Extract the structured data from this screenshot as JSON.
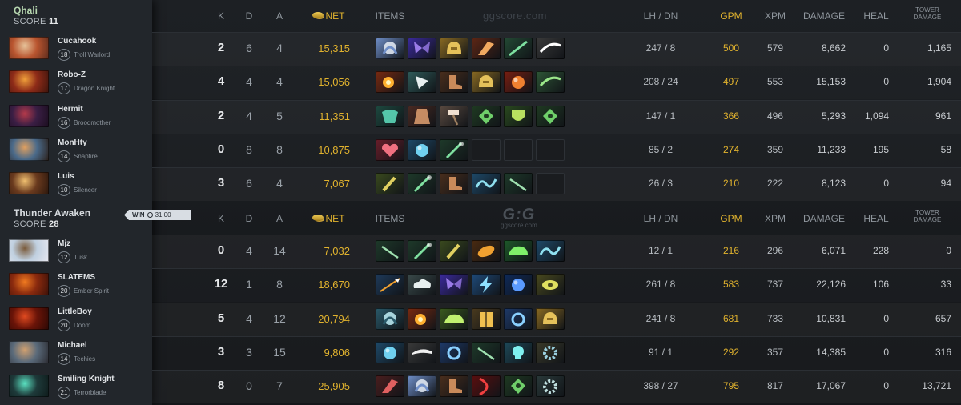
{
  "headers": {
    "k": "K",
    "d": "D",
    "a": "A",
    "net": "NET",
    "items": "ITEMS",
    "lhdn": "LH / DN",
    "gpm": "GPM",
    "xpm": "XPM",
    "damage": "DAMAGE",
    "heal": "HEAL",
    "tower": "TOWER DAMAGE"
  },
  "watermark_top": "ggscore.com",
  "watermark_logo": "G:G",
  "watermark_logo_sub": "ggscore.com",
  "result": {
    "label": "WIN",
    "time": "31:00"
  },
  "teams": [
    {
      "name": "Qhali",
      "score_label": "SCORE",
      "score": "11",
      "players": [
        {
          "name": "Cucahook",
          "level": "18",
          "hero": "Troll Warlord",
          "k": "2",
          "d": "6",
          "a": "4",
          "net": "15,315",
          "lhdn": "247 / 8",
          "gpm": "500",
          "xpm": "579",
          "damage": "8,662",
          "heal": "0",
          "tower": "1,165",
          "portrait": [
            "#b9552f",
            "#e6c39a",
            "#5a2a1c"
          ],
          "items": [
            {
              "icon": "skadi-icon",
              "colors": [
                "#6f8fc9",
                "#e8eef8"
              ]
            },
            {
              "icon": "butterfly-icon",
              "colors": [
                "#3b2a9e",
                "#9a7be8"
              ]
            },
            {
              "icon": "helmet-icon",
              "colors": [
                "#8a6a22",
                "#e5c15a"
              ]
            },
            {
              "icon": "claw-icon",
              "colors": [
                "#5e2614",
                "#f0a860"
              ]
            },
            {
              "icon": "sword-icon",
              "colors": [
                "#234a34",
                "#7de0a0"
              ]
            },
            {
              "icon": "scythe-icon",
              "colors": [
                "#3a3a3a",
                "#ffffff"
              ]
            }
          ]
        },
        {
          "name": "Robo-Z",
          "level": "17",
          "hero": "Dragon Knight",
          "k": "4",
          "d": "4",
          "a": "4",
          "net": "15,056",
          "lhdn": "208 / 24",
          "gpm": "497",
          "xpm": "553",
          "damage": "15,153",
          "heal": "0",
          "tower": "1,904",
          "portrait": [
            "#8e2b18",
            "#f0a03a",
            "#3c140c"
          ],
          "items": [
            {
              "icon": "radiance-icon",
              "colors": [
                "#7a2a10",
                "#ffb030"
              ]
            },
            {
              "icon": "axe-icon",
              "colors": [
                "#2f5c5a",
                "#e8f0f0"
              ]
            },
            {
              "icon": "boots-icon",
              "colors": [
                "#4a2e1c",
                "#c98a5a"
              ]
            },
            {
              "icon": "helmet-icon",
              "colors": [
                "#8a6a22",
                "#e5c15a"
              ]
            },
            {
              "icon": "orb-icon",
              "colors": [
                "#7a1e10",
                "#f08030"
              ]
            },
            {
              "icon": "scythe-icon",
              "colors": [
                "#2e5636",
                "#9be88a"
              ]
            }
          ]
        },
        {
          "name": "Hermit",
          "level": "16",
          "hero": "Broodmother",
          "k": "2",
          "d": "4",
          "a": "5",
          "net": "11,351",
          "lhdn": "147 / 1",
          "gpm": "366",
          "xpm": "496",
          "damage": "5,293",
          "heal": "1,094",
          "tower": "961",
          "portrait": [
            "#3a1e44",
            "#b53a4a",
            "#1a0d1e"
          ],
          "items": [
            {
              "icon": "mask-icon",
              "colors": [
                "#1d4a40",
                "#5fe0c0"
              ]
            },
            {
              "icon": "cape-icon",
              "colors": [
                "#4a2a22",
                "#e0a070"
              ]
            },
            {
              "icon": "hammer-icon",
              "colors": [
                "#5a4a40",
                "#f0e0d0"
              ]
            },
            {
              "icon": "amulet-icon",
              "colors": [
                "#1f3a22",
                "#6fcf6a"
              ]
            },
            {
              "icon": "shield-icon",
              "colors": [
                "#2a4a1e",
                "#b8e060"
              ]
            },
            {
              "icon": "amulet-icon",
              "colors": [
                "#1f3a22",
                "#6fcf6a"
              ]
            }
          ]
        },
        {
          "name": "MonHty",
          "level": "14",
          "hero": "Snapfire",
          "k": "0",
          "d": "8",
          "a": "8",
          "net": "10,875",
          "lhdn": "85 / 2",
          "gpm": "274",
          "xpm": "359",
          "damage": "11,233",
          "heal": "195",
          "tower": "58",
          "portrait": [
            "#4a6a8a",
            "#e0a060",
            "#2a1e18"
          ],
          "items": [
            {
              "icon": "heart-icon",
              "colors": [
                "#6a1e2a",
                "#f07080"
              ]
            },
            {
              "icon": "orb-icon",
              "colors": [
                "#1e4a6a",
                "#6fd0f0"
              ]
            },
            {
              "icon": "staff-icon",
              "colors": [
                "#1e3a2a",
                "#7fe0a0"
              ]
            },
            {
              "icon": "empty-slot",
              "colors": [
                "#1a1c1f",
                "#1a1c1f"
              ]
            },
            {
              "icon": "empty-slot",
              "colors": [
                "#1a1c1f",
                "#1a1c1f"
              ]
            },
            {
              "icon": "empty-slot",
              "colors": [
                "#1a1c1f",
                "#1a1c1f"
              ]
            }
          ]
        },
        {
          "name": "Luis",
          "level": "10",
          "hero": "Silencer",
          "k": "3",
          "d": "6",
          "a": "4",
          "net": "7,067",
          "lhdn": "26 / 3",
          "gpm": "210",
          "xpm": "222",
          "damage": "8,123",
          "heal": "0",
          "tower": "94",
          "portrait": [
            "#6a3a1e",
            "#f0c070",
            "#2a160c"
          ],
          "items": [
            {
              "icon": "wand-icon",
              "colors": [
                "#3a4a1e",
                "#e0d060"
              ]
            },
            {
              "icon": "staff-icon",
              "colors": [
                "#1e3a2a",
                "#7fe0a0"
              ]
            },
            {
              "icon": "boots-icon",
              "colors": [
                "#4a2e1c",
                "#c98a5a"
              ]
            },
            {
              "icon": "wave-icon",
              "colors": [
                "#1e4a6a",
                "#8fe0f0"
              ]
            },
            {
              "icon": "stick-icon",
              "colors": [
                "#1e3a2a",
                "#9fe0b0"
              ]
            },
            {
              "icon": "empty-slot",
              "colors": [
                "#1a1c1f",
                "#1a1c1f"
              ]
            }
          ]
        }
      ]
    },
    {
      "name": "Thunder Awaken",
      "score_label": "SCORE",
      "score": "28",
      "players": [
        {
          "name": "Mjz",
          "level": "12",
          "hero": "Tusk",
          "k": "0",
          "d": "4",
          "a": "14",
          "net": "7,032",
          "lhdn": "12 / 1",
          "gpm": "216",
          "xpm": "296",
          "damage": "6,071",
          "heal": "228",
          "tower": "0",
          "portrait": [
            "#c0d0e0",
            "#7a5a3a",
            "#e8e8f0"
          ],
          "items": [
            {
              "icon": "stick-icon",
              "colors": [
                "#1e3a2a",
                "#9fe0b0"
              ]
            },
            {
              "icon": "staff-icon",
              "colors": [
                "#1e3a2a",
                "#7fe0a0"
              ]
            },
            {
              "icon": "wand-icon",
              "colors": [
                "#3a4a1e",
                "#e0d060"
              ]
            },
            {
              "icon": "feather-icon",
              "colors": [
                "#4a2a10",
                "#f0a030"
              ]
            },
            {
              "icon": "slipper-icon",
              "colors": [
                "#1e5a2a",
                "#7ff06a"
              ]
            },
            {
              "icon": "wave-icon",
              "colors": [
                "#1e4a6a",
                "#8fe0f0"
              ]
            }
          ]
        },
        {
          "name": "SLATEMS",
          "level": "20",
          "hero": "Ember Spirit",
          "k": "12",
          "d": "1",
          "a": "8",
          "net": "18,670",
          "lhdn": "261 / 8",
          "gpm": "583",
          "xpm": "737",
          "damage": "22,126",
          "heal": "106",
          "tower": "33",
          "portrait": [
            "#8a2a0e",
            "#f07a20",
            "#3a1008"
          ],
          "items": [
            {
              "icon": "spear-icon",
              "colors": [
                "#1e3a5a",
                "#f0a030"
              ]
            },
            {
              "icon": "cloud-icon",
              "colors": [
                "#3a4a4a",
                "#e8f0f0"
              ]
            },
            {
              "icon": "butterfly-icon",
              "colors": [
                "#3b2a9e",
                "#9a7be8"
              ]
            },
            {
              "icon": "lightning-icon",
              "colors": [
                "#1e4a7a",
                "#8fe0ff"
              ]
            },
            {
              "icon": "orb-icon",
              "colors": [
                "#0e2a5a",
                "#5a9aff"
              ]
            },
            {
              "icon": "eye-icon",
              "colors": [
                "#4a4a1e",
                "#e0e060"
              ]
            }
          ]
        },
        {
          "name": "LittleBoy",
          "level": "20",
          "hero": "Doom",
          "k": "5",
          "d": "4",
          "a": "12",
          "net": "20,794",
          "lhdn": "241 / 8",
          "gpm": "681",
          "xpm": "733",
          "damage": "10,831",
          "heal": "0",
          "tower": "657",
          "portrait": [
            "#6a1408",
            "#e04a20",
            "#2a0804"
          ],
          "items": [
            {
              "icon": "skadi-icon",
              "colors": [
                "#2a5a6a",
                "#c0f0f8"
              ]
            },
            {
              "icon": "radiance-icon",
              "colors": [
                "#7a2a10",
                "#ffb030"
              ]
            },
            {
              "icon": "slipper-icon",
              "colors": [
                "#3a5a1e",
                "#c0f070"
              ]
            },
            {
              "icon": "book-icon",
              "colors": [
                "#4a3a1e",
                "#f0c050"
              ]
            },
            {
              "icon": "ring-icon",
              "colors": [
                "#1e3a6a",
                "#8ad0ff"
              ]
            },
            {
              "icon": "helmet-icon",
              "colors": [
                "#8a6a22",
                "#e5c15a"
              ]
            }
          ]
        },
        {
          "name": "Michael",
          "level": "14",
          "hero": "Techies",
          "k": "3",
          "d": "3",
          "a": "15",
          "net": "9,806",
          "lhdn": "91 / 1",
          "gpm": "292",
          "xpm": "357",
          "damage": "14,385",
          "heal": "0",
          "tower": "316",
          "portrait": [
            "#5a6a7a",
            "#d0a070",
            "#2a2a30"
          ],
          "items": [
            {
              "icon": "orb-icon",
              "colors": [
                "#1e4a6a",
                "#6fd0f0"
              ]
            },
            {
              "icon": "blade-icon",
              "colors": [
                "#3a3a3a",
                "#f0f0f0"
              ]
            },
            {
              "icon": "ring-icon",
              "colors": [
                "#1e3a6a",
                "#8ad0ff"
              ]
            },
            {
              "icon": "stick-icon",
              "colors": [
                "#1e3a2a",
                "#9fe0b0"
              ]
            },
            {
              "icon": "skull-icon",
              "colors": [
                "#1e4a5a",
                "#7ff0f0"
              ]
            },
            {
              "icon": "gear-icon",
              "colors": [
                "#3a3a2a",
                "#9ad0e0"
              ]
            }
          ]
        },
        {
          "name": "Smiling Knight",
          "level": "21",
          "hero": "Terrorblade",
          "k": "8",
          "d": "0",
          "a": "7",
          "net": "25,905",
          "lhdn": "398 / 27",
          "gpm": "795",
          "xpm": "817",
          "damage": "17,067",
          "heal": "0",
          "tower": "13,721",
          "portrait": [
            "#1e3a3a",
            "#5ae0c0",
            "#0e1a1a"
          ],
          "items": [
            {
              "icon": "claw-icon",
              "colors": [
                "#4a1e1e",
                "#e06060"
              ]
            },
            {
              "icon": "skadi-icon",
              "colors": [
                "#6f8fc9",
                "#e8eef8"
              ]
            },
            {
              "icon": "boots-icon",
              "colors": [
                "#4a2e1c",
                "#c98a5a"
              ]
            },
            {
              "icon": "bow-icon",
              "colors": [
                "#5a0e0e",
                "#f04040"
              ]
            },
            {
              "icon": "amulet-icon",
              "colors": [
                "#1f3a22",
                "#6fcf6a"
              ]
            },
            {
              "icon": "gear-icon",
              "colors": [
                "#2a3a3a",
                "#c0e0e0"
              ]
            }
          ]
        }
      ]
    }
  ]
}
